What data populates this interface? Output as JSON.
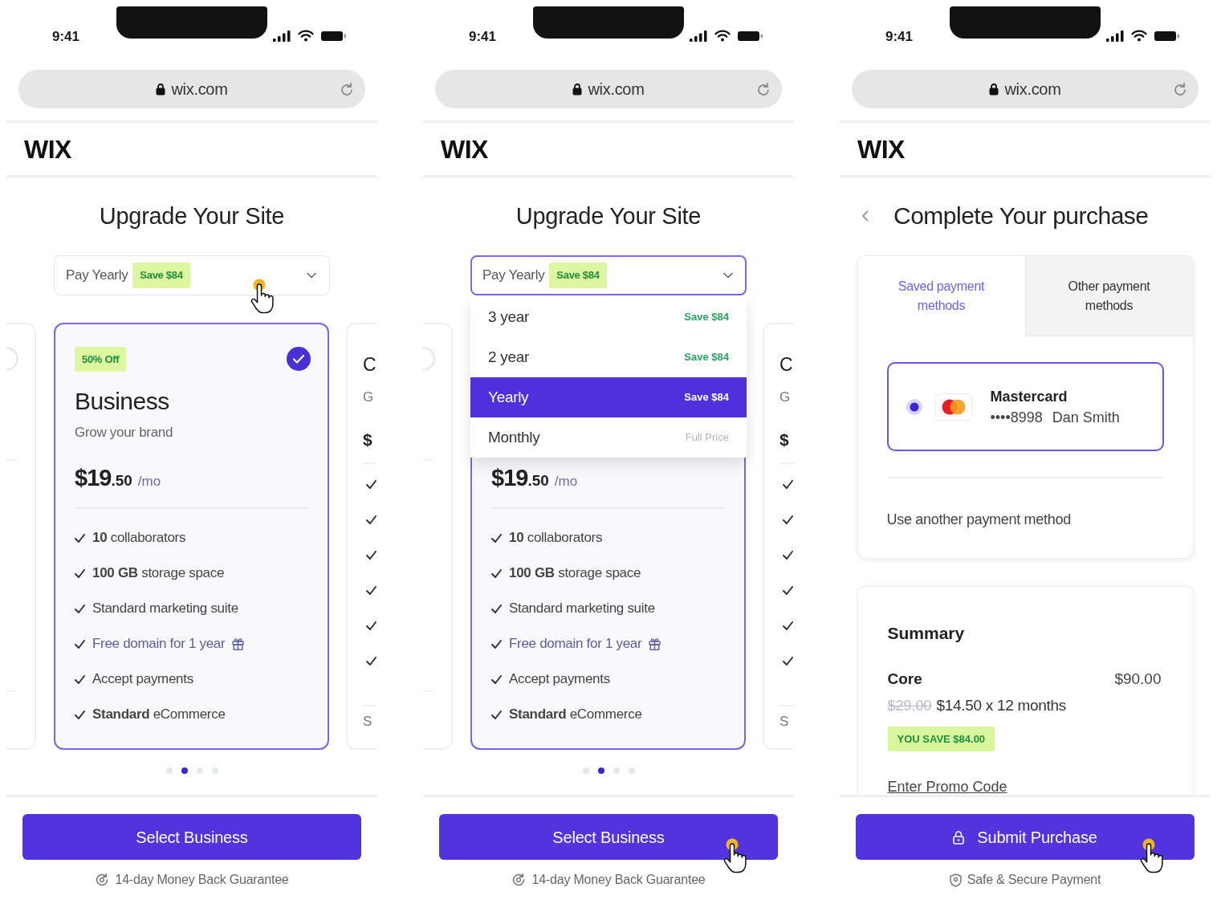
{
  "screens": [
    {
      "kind": "plans",
      "status_bar": {
        "time": "9:41"
      },
      "address_bar": {
        "url": "wix.com"
      },
      "logo": "WIX",
      "title": "Upgrade Your Site",
      "billing_select": {
        "label": "Pay Yearly",
        "badge": "Save $84",
        "open": false,
        "clicked": true
      },
      "carousel": {
        "previous_plan": {
          "selected": false
        },
        "current_plan": {
          "badge": "50% Off",
          "name": "Business",
          "tagline": "Grow your brand",
          "selected": true,
          "price": {
            "amount": "$19",
            "cents": ".50",
            "period": "/mo"
          },
          "features": [
            {
              "kind": "plain",
              "text": "**10** collaborators"
            },
            {
              "kind": "plain",
              "text": "**100 GB** storage space"
            },
            {
              "kind": "plain",
              "text": "Standard marketing suite"
            },
            {
              "kind": "gift",
              "text": "Free domain for 1 year"
            },
            {
              "kind": "plain",
              "text": "Accept payments"
            },
            {
              "kind": "plain",
              "text": "**Standard** eCommerce"
            }
          ]
        },
        "next_plan": {
          "name": "C",
          "tagline": "G",
          "price": "$",
          "features": [
            {
              "checked": true
            },
            {
              "checked": true
            },
            {
              "checked": true
            },
            {
              "checked": true
            },
            {
              "checked": true
            },
            {
              "checked": true
            }
          ],
          "note": "S"
        },
        "dots": [
          {
            "selected": false
          },
          {
            "selected": true
          },
          {
            "selected": false
          },
          {
            "selected": false
          }
        ]
      },
      "button": {
        "label": "Select Business"
      },
      "note": "14-day Money Back Guarantee"
    },
    {
      "kind": "plans",
      "status_bar": {
        "time": "9:41"
      },
      "address_bar": {
        "url": "wix.com"
      },
      "logo": "WIX",
      "title": "Upgrade Your Site",
      "billing_select": {
        "label": "Pay Yearly",
        "badge": "Save $84",
        "open": true,
        "options": [
          {
            "label": "3 year",
            "note": "Save $84",
            "kind": "save",
            "selected": false
          },
          {
            "label": "2 year",
            "note": "Save $84",
            "kind": "save",
            "selected": false
          },
          {
            "label": "Yearly",
            "note": "Save $84",
            "kind": "save",
            "selected": true
          },
          {
            "label": "Monthly",
            "note": "Full Price",
            "kind": "full",
            "selected": false
          }
        ]
      },
      "carousel": {
        "previous_plan": {
          "selected": false
        },
        "current_plan": {
          "selected": true,
          "price": {
            "amount": "$19",
            "cents": ".50",
            "period": "/mo"
          },
          "features": [
            {
              "kind": "plain",
              "text": "**10** collaborators"
            },
            {
              "kind": "plain",
              "text": "**100 GB** storage space"
            },
            {
              "kind": "plain",
              "text": "Standard marketing suite"
            },
            {
              "kind": "gift",
              "text": "Free domain for 1 year"
            },
            {
              "kind": "plain",
              "text": "Accept payments"
            },
            {
              "kind": "plain",
              "text": "**Standard** eCommerce"
            }
          ]
        },
        "next_plan": {
          "name": "C",
          "tagline": "G",
          "price": "$",
          "features": [
            {
              "checked": true
            },
            {
              "checked": true
            },
            {
              "checked": true
            },
            {
              "checked": true
            },
            {
              "checked": true
            },
            {
              "checked": true
            }
          ],
          "note": "S"
        },
        "dots": [
          {
            "selected": false
          },
          {
            "selected": true
          },
          {
            "selected": false
          },
          {
            "selected": false
          }
        ]
      },
      "button": {
        "label": "Select Business",
        "clicked": true
      },
      "note": "14-day Money Back Guarantee"
    },
    {
      "kind": "checkout",
      "status_bar": {
        "time": "9:41"
      },
      "address_bar": {
        "url": "wix.com"
      },
      "logo": "WIX",
      "title": "Complete Your purchase",
      "payment": {
        "tabs": [
          {
            "label": "Saved payment methods",
            "selected": true
          },
          {
            "label": "Other payment methods",
            "selected": false
          }
        ],
        "saved_cards": [
          {
            "brand": "Mastercard",
            "number": "••••8998",
            "holder": "Dan Smith",
            "selected": true
          }
        ],
        "link": "Use another payment method"
      },
      "summary": {
        "title": "Summary",
        "item": "Core",
        "total": "$90.00",
        "old_price": "$29.00",
        "price": "$14.50 x 12 months",
        "savings": "YOU SAVE $84.00",
        "promo_link": "Enter Promo Code"
      },
      "button": {
        "label": "Submit Purchase",
        "clicked": true
      },
      "note": "Safe & Secure Payment"
    }
  ]
}
